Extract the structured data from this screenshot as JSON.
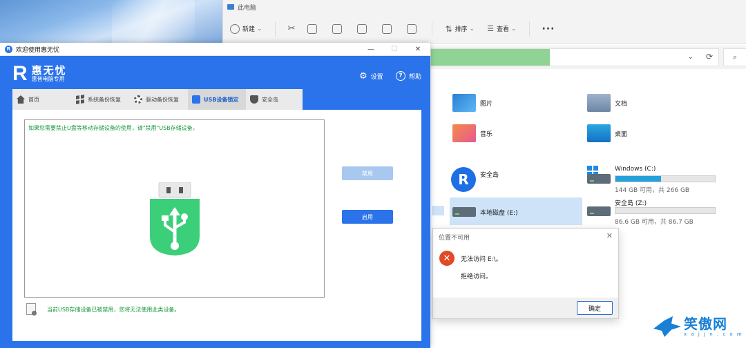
{
  "desktop": {
    "wallpaper": "blue-wallpaper"
  },
  "explorer": {
    "title": "此电脑",
    "toolbar": {
      "new_label": "新建",
      "sort_label": "排序",
      "view_label": "查看",
      "more_label": "···"
    },
    "folders": [
      {
        "name": "图片",
        "icon": "pictures-folder-icon"
      },
      {
        "name": "文档",
        "icon": "documents-folder-icon"
      },
      {
        "name": "音乐",
        "icon": "music-folder-icon"
      },
      {
        "name": "桌面",
        "icon": "desktop-folder-icon"
      }
    ],
    "drives": {
      "anquandao": {
        "label": "安全岛"
      },
      "c": {
        "label": "Windows  (C:)",
        "free_text": "144 GB 可用，共 266 GB",
        "used_fraction": 0.46
      },
      "e": {
        "label": "本地磁盘 (E:)"
      },
      "z": {
        "label": "安全岛  (Z:)",
        "free_text": "86.6 GB 可用，共 86.7 GB",
        "used_fraction": 0.0
      }
    }
  },
  "dialog": {
    "title": "位置不可用",
    "message": "无法访问 E:\\。",
    "detail": "拒绝访问。",
    "ok_label": "确定"
  },
  "app": {
    "window_title": "欢迎使用惠无忧",
    "brand_logo": "R",
    "brand_name": "惠无忧",
    "brand_tagline": "惠普电脑专用",
    "settings_label": "设置",
    "help_label": "帮助",
    "tabs": [
      {
        "label": "首页"
      },
      {
        "label": "系统备份恢复"
      },
      {
        "label": "驱动备份恢复"
      },
      {
        "label": "USB设备锁定"
      },
      {
        "label": "安全岛"
      }
    ],
    "hint": "如果您需要禁止U盘等移动存储设备的使用，请\"禁用\"USB存储设备。",
    "disable_label": "禁用",
    "enable_label": "启用",
    "status": "当前USB存储设备已被禁用，您将无法使用此类设备。",
    "accent_color": "#2b73ea",
    "usb_color": "#3ccf7a"
  },
  "watermark": {
    "text": "笑傲网",
    "sub": "x a j j n . c o m"
  }
}
